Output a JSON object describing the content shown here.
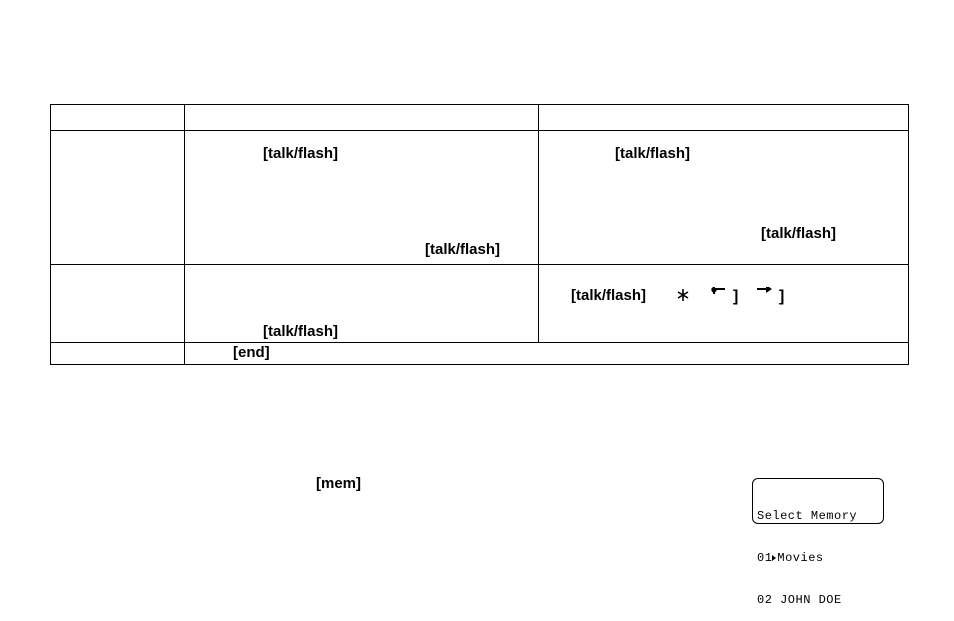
{
  "table": {
    "r2b_tf": "[talk/flash]",
    "r2c_tf": "[talk/flash]",
    "r2b_tf2": "[talk/flash]",
    "r2c_tf2": "[talk/flash]",
    "r3b_tf": "[talk/flash]",
    "r3c_tf": "[talk/flash]",
    "r3c_star": "*",
    "r3c_left_br": "]",
    "r3c_right_br": "]",
    "r4b_end": "[end]"
  },
  "mem_label": "[mem]",
  "lcd": {
    "line1": "Select Memory",
    "line2a": "01",
    "line2b": "Movies",
    "line3": "02 JOHN DOE"
  }
}
